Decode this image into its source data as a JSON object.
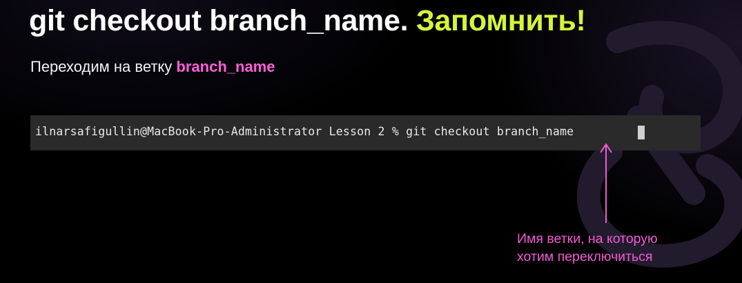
{
  "slide": {
    "title_main": "git checkout branch_name.",
    "title_accent": "Запомнить!",
    "subtitle_prefix": "Переходим на ветку",
    "subtitle_highlight": "branch_name"
  },
  "terminal": {
    "command_line": "ilnarsafigullin@MacBook-Pro-Administrator Lesson 2 % git checkout branch_name"
  },
  "annotation": {
    "line1": "Имя ветки, на которую",
    "line2": "хотим переключиться"
  },
  "colors": {
    "title": "#ffffff",
    "accent": "#d4f53c",
    "highlight": "#ff5fd9",
    "annotation": "#f25ad6",
    "terminal_bg": "#2a2a2a"
  }
}
